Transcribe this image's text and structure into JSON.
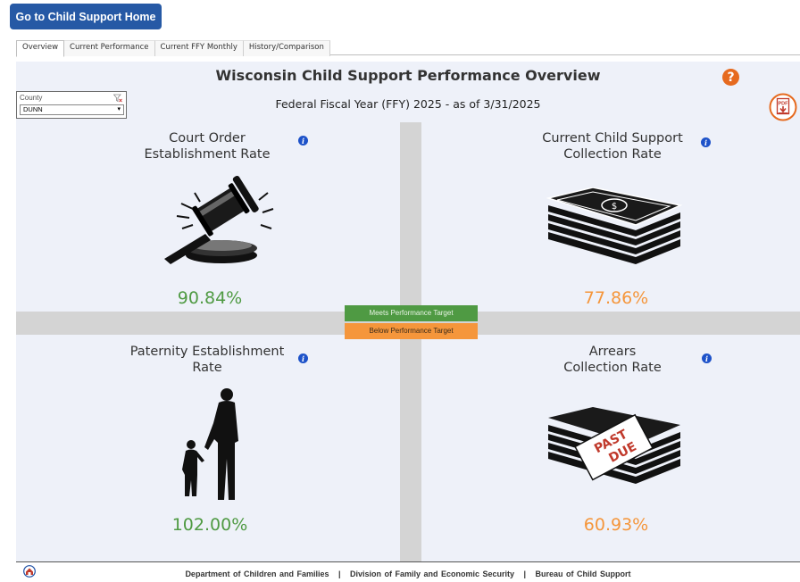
{
  "home_button": "Go to Child Support Home",
  "tabs": [
    "Overview",
    "Current Performance",
    "Current FFY Monthly",
    "History/Comparison"
  ],
  "title": "Wisconsin Child Support Performance Overview",
  "subtitle": "Federal Fiscal Year (FFY) 2025 - as of 3/31/2025",
  "county": {
    "label": "County",
    "value": "DUNN"
  },
  "legend": {
    "meets": "Meets Performance Target",
    "below": "Below Performance Target"
  },
  "colors": {
    "meets": "#4f9a43",
    "below": "#f5963b"
  },
  "metrics": {
    "court": {
      "title1": "Court Order",
      "title2": "Establishment Rate",
      "value": "90.84%",
      "status": "meets",
      "icon": "gavel-icon"
    },
    "current": {
      "title1": "Current Child Support",
      "title2": "Collection Rate",
      "value": "77.86%",
      "status": "below",
      "icon": "money-stack-icon"
    },
    "paternity": {
      "title1": "Paternity Establishment",
      "title2": "Rate",
      "value": "102.00%",
      "status": "meets",
      "icon": "father-child-icon"
    },
    "arrears": {
      "title1": "Arrears",
      "title2": "Collection Rate",
      "value": "60.93%",
      "status": "below",
      "icon": "past-due-money-icon"
    }
  },
  "stamp": {
    "line1": "PAST",
    "line2": "DUE"
  },
  "footer": "Department of Children and Families   |   Division of Family and Economic Security   |   Bureau of Child Support"
}
